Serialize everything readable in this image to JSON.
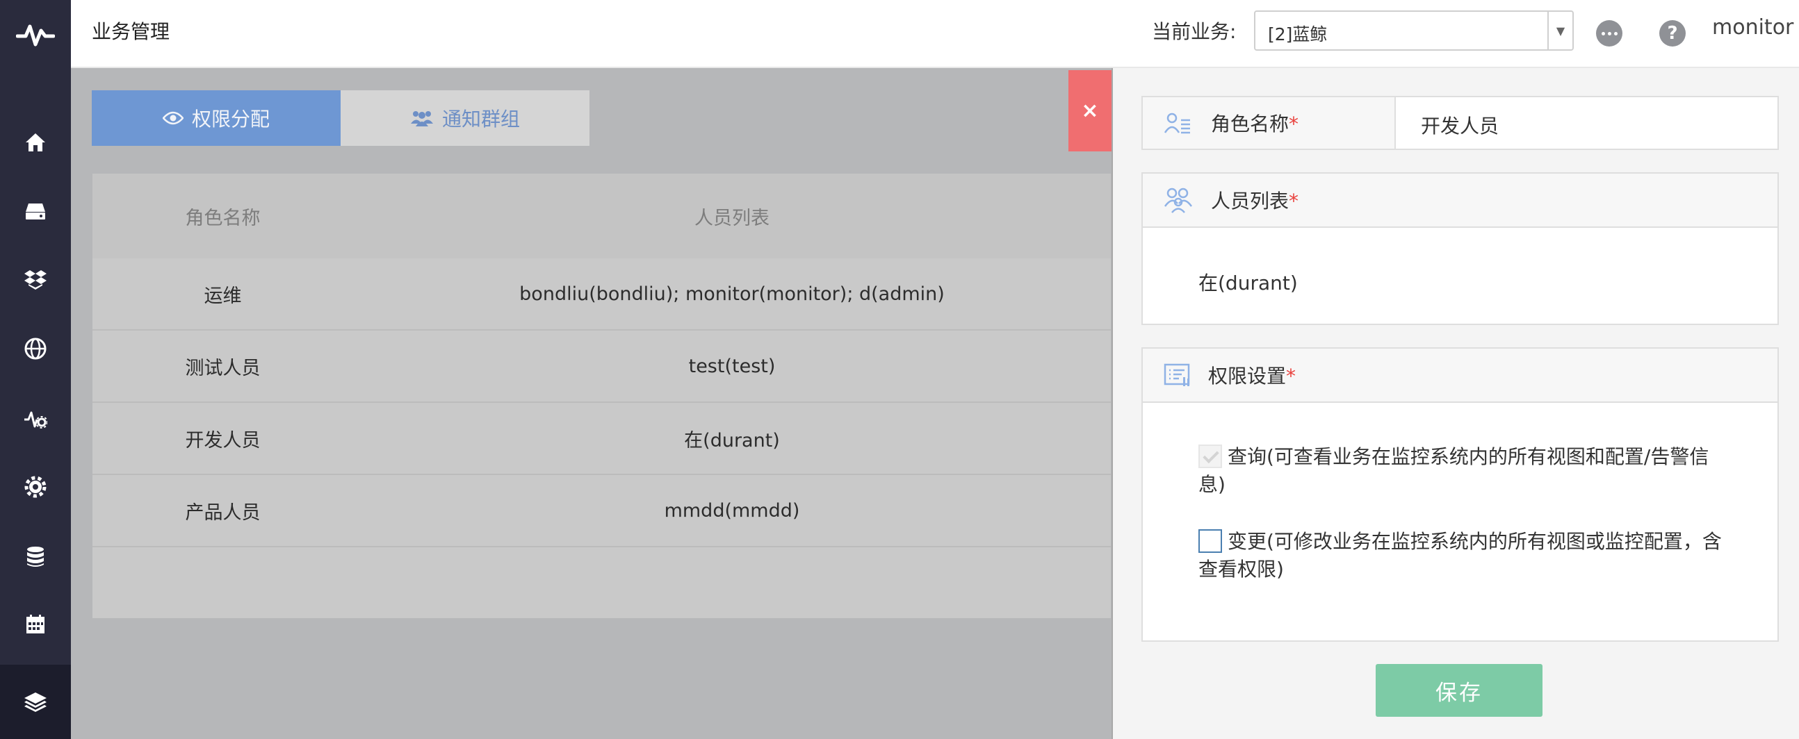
{
  "header": {
    "title": "业务管理",
    "biz_label": "当前业务:",
    "biz_selected": "[2]蓝鲸",
    "user": "monitor"
  },
  "sidebar": {
    "items": [
      {
        "icon": "home-icon"
      },
      {
        "icon": "server-icon"
      },
      {
        "icon": "box-icon"
      },
      {
        "icon": "globe-icon"
      },
      {
        "icon": "pulse-gear-icon"
      },
      {
        "icon": "gear-icon"
      },
      {
        "icon": "database-icon"
      },
      {
        "icon": "calendar-icon"
      },
      {
        "icon": "layers-icon",
        "active": true
      }
    ]
  },
  "tabs": [
    {
      "label": "权限分配",
      "icon": "eye-icon",
      "active": true
    },
    {
      "label": "通知群组",
      "icon": "users-icon",
      "active": false
    }
  ],
  "table": {
    "columns": [
      "角色名称",
      "人员列表"
    ],
    "rows": [
      {
        "role": "运维",
        "members": "bondliu(bondliu); monitor(monitor); d(admin)"
      },
      {
        "role": "测试人员",
        "members": "test(test)"
      },
      {
        "role": "开发人员",
        "members": "在(durant)"
      },
      {
        "role": "产品人员",
        "members": "mmdd(mmdd)"
      }
    ]
  },
  "panel": {
    "close_label": "×",
    "role_name_label": "角色名称",
    "role_name_value": "开发人员",
    "member_list_label": "人员列表",
    "member_list_value": "在(durant)",
    "perm_label": "权限设置",
    "required_mark": "*",
    "perm_items": [
      {
        "label": "查询(可查看业务在监控系统内的所有视图和配置/告警信息)",
        "checked": true,
        "disabled": true
      },
      {
        "label": "变更(可修改业务在监控系统内的所有视图或监控配置，含查看权限)",
        "checked": false,
        "disabled": false
      }
    ],
    "save_label": "保存"
  },
  "colors": {
    "sidebar_bg": "#2a2b3d",
    "tab_active": "#6e97d3",
    "close": "#f06e70",
    "save": "#7dcba6",
    "required": "#e9423e"
  }
}
